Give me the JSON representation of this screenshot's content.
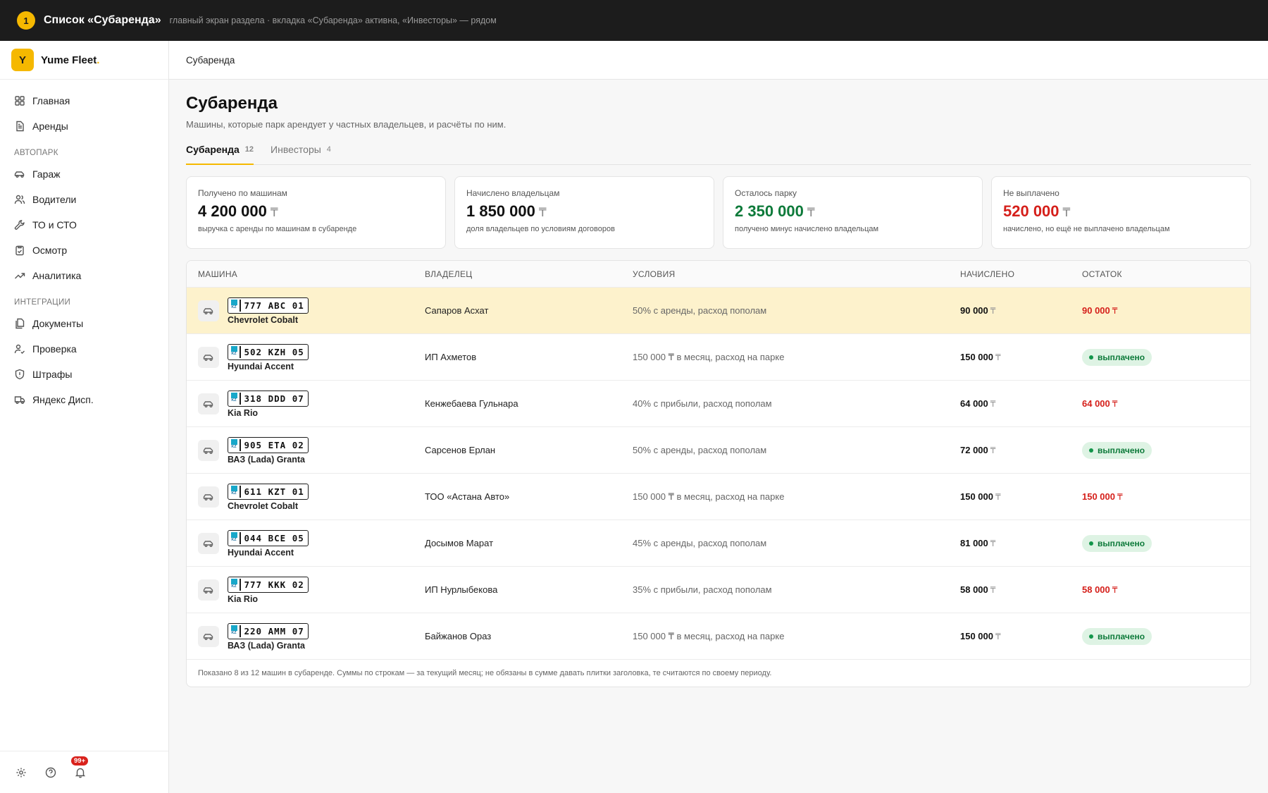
{
  "annotation": {
    "number": "1",
    "title": "Список «Субаренда»",
    "note": "главный экран раздела · вкладка «Субаренда» активна, «Инвесторы» — рядом"
  },
  "brand": {
    "logo": "Y",
    "name": "Yume Fleet",
    "dot": "."
  },
  "nav": {
    "main": [
      {
        "label": "Главная",
        "icon": "grid-icon"
      },
      {
        "label": "Аренды",
        "icon": "document-icon"
      }
    ],
    "section_fleet": "АВТОПАРК",
    "fleet": [
      {
        "label": "Гараж",
        "icon": "car-icon"
      },
      {
        "label": "Водители",
        "icon": "users-icon"
      },
      {
        "label": "ТО и СТО",
        "icon": "wrench-icon"
      },
      {
        "label": "Осмотр",
        "icon": "clipboard-icon"
      },
      {
        "label": "Аналитика",
        "icon": "trend-icon"
      }
    ],
    "section_integrations": "ИНТЕГРАЦИИ",
    "integrations": [
      {
        "label": "Документы",
        "icon": "files-icon"
      },
      {
        "label": "Проверка",
        "icon": "user-check-icon"
      },
      {
        "label": "Штрафы",
        "icon": "shield-icon"
      },
      {
        "label": "Яндекс Дисп.",
        "icon": "truck-icon"
      }
    ],
    "notifications_badge": "99+"
  },
  "breadcrumb": "Субаренда",
  "page": {
    "title": "Субаренда",
    "subtitle": "Машины, которые парк арендует у частных владельцев, и расчёты по ним."
  },
  "tabs": [
    {
      "label": "Субаренда",
      "count": "12",
      "active": true
    },
    {
      "label": "Инвесторы",
      "count": "4",
      "active": false
    }
  ],
  "currency": "₸",
  "kpis": [
    {
      "label": "Получено по машинам",
      "value": "4 200 000",
      "hint": "выручка с аренды по машинам в субаренде",
      "tone": "default"
    },
    {
      "label": "Начислено владельцам",
      "value": "1 850 000",
      "hint": "доля владельцев по условиям договоров",
      "tone": "default"
    },
    {
      "label": "Осталось парку",
      "value": "2 350 000",
      "hint": "получено минус начислено владельцам",
      "tone": "green"
    },
    {
      "label": "Не выплачено",
      "value": "520 000",
      "hint": "начислено, но ещё не выплачено владельцам",
      "tone": "red"
    }
  ],
  "table": {
    "columns": [
      "МАШИНА",
      "ВЛАДЕЛЕЦ",
      "УСЛОВИЯ",
      "НАЧИСЛЕНО",
      "ОСТАТОК"
    ],
    "plate_country": "KZ",
    "paid_label": "выплачено",
    "rows": [
      {
        "plate": "777 ABC 01",
        "model": "Chevrolet Cobalt",
        "owner": "Сапаров Асхат",
        "terms": "50% с аренды, расход пополам",
        "accrued": "90 000",
        "remainder": "90 000",
        "paid": false,
        "highlight": true
      },
      {
        "plate": "502 KZH 05",
        "model": "Hyundai Accent",
        "owner": "ИП Ахметов",
        "terms": "150 000 ₸ в месяц, расход на парке",
        "accrued": "150 000",
        "remainder": "",
        "paid": true,
        "highlight": false
      },
      {
        "plate": "318 DDD 07",
        "model": "Kia Rio",
        "owner": "Кенжебаева Гульнара",
        "terms": "40% с прибыли, расход пополам",
        "accrued": "64 000",
        "remainder": "64 000",
        "paid": false,
        "highlight": false
      },
      {
        "plate": "905 ETA 02",
        "model": "ВАЗ (Lada) Granta",
        "owner": "Сарсенов Ерлан",
        "terms": "50% с аренды, расход пополам",
        "accrued": "72 000",
        "remainder": "",
        "paid": true,
        "highlight": false
      },
      {
        "plate": "611 KZT 01",
        "model": "Chevrolet Cobalt",
        "owner": "ТОО «Астана Авто»",
        "terms": "150 000 ₸ в месяц, расход на парке",
        "accrued": "150 000",
        "remainder": "150 000",
        "paid": false,
        "highlight": false
      },
      {
        "plate": "044 BCE 05",
        "model": "Hyundai Accent",
        "owner": "Досымов Марат",
        "terms": "45% с аренды, расход пополам",
        "accrued": "81 000",
        "remainder": "",
        "paid": true,
        "highlight": false
      },
      {
        "plate": "777 KKK 02",
        "model": "Kia Rio",
        "owner": "ИП Нурлыбекова",
        "terms": "35% с прибыли, расход пополам",
        "accrued": "58 000",
        "remainder": "58 000",
        "paid": false,
        "highlight": false
      },
      {
        "plate": "220 AMM 07",
        "model": "ВАЗ (Lada) Granta",
        "owner": "Байжанов Ораз",
        "terms": "150 000 ₸ в месяц, расход на парке",
        "accrued": "150 000",
        "remainder": "",
        "paid": true,
        "highlight": false
      }
    ],
    "footer": "Показано 8 из 12 машин в субаренде. Суммы по строкам — за текущий месяц; не обязаны в сумме давать плитки заголовка, те считаются по своему периоду."
  }
}
